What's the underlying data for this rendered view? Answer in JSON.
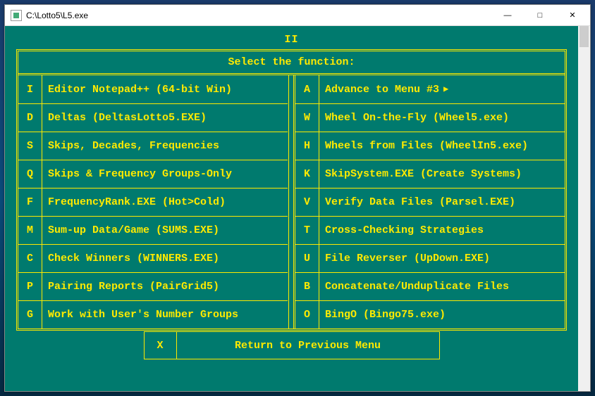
{
  "window": {
    "title": "C:\\Lotto5\\L5.exe",
    "minimize": "—",
    "maximize": "□",
    "close": "✕"
  },
  "page_header": "II",
  "prompt": "Select the function:",
  "left_items": [
    {
      "key": "I",
      "label": "Editor Notepad++ (64-bit Win)"
    },
    {
      "key": "D",
      "label": "Deltas (DeltasLotto5.EXE)"
    },
    {
      "key": "S",
      "label": "Skips, Decades, Frequencies"
    },
    {
      "key": "Q",
      "label": "Skips & Frequency Groups-Only"
    },
    {
      "key": "F",
      "label": "FrequencyRank.EXE (Hot>Cold)"
    },
    {
      "key": "M",
      "label": "Sum-up Data/Game (SUMS.EXE)"
    },
    {
      "key": "C",
      "label": "Check Winners (WINNERS.EXE)"
    },
    {
      "key": "P",
      "label": "Pairing Reports (PairGrid5)"
    },
    {
      "key": "G",
      "label": "Work with User's Number Groups"
    }
  ],
  "right_items": [
    {
      "key": "A",
      "label": "Advance to Menu #3",
      "arrow": true
    },
    {
      "key": "W",
      "label": "Wheel On-the-Fly (Wheel5.exe)"
    },
    {
      "key": "H",
      "label": "Wheels from Files (WheelIn5.exe)"
    },
    {
      "key": "K",
      "label": "SkipSystem.EXE (Create Systems)"
    },
    {
      "key": "V",
      "label": "Verify Data Files (Parsel.EXE)"
    },
    {
      "key": "T",
      "label": "Cross-Checking Strategies"
    },
    {
      "key": "U",
      "label": "File Reverser (UpDown.EXE)"
    },
    {
      "key": "B",
      "label": "Concatenate/Unduplicate Files"
    },
    {
      "key": "O",
      "label": "BingO (Bingo75.exe)"
    }
  ],
  "return_item": {
    "key": "X",
    "label": "Return to Previous Menu"
  }
}
